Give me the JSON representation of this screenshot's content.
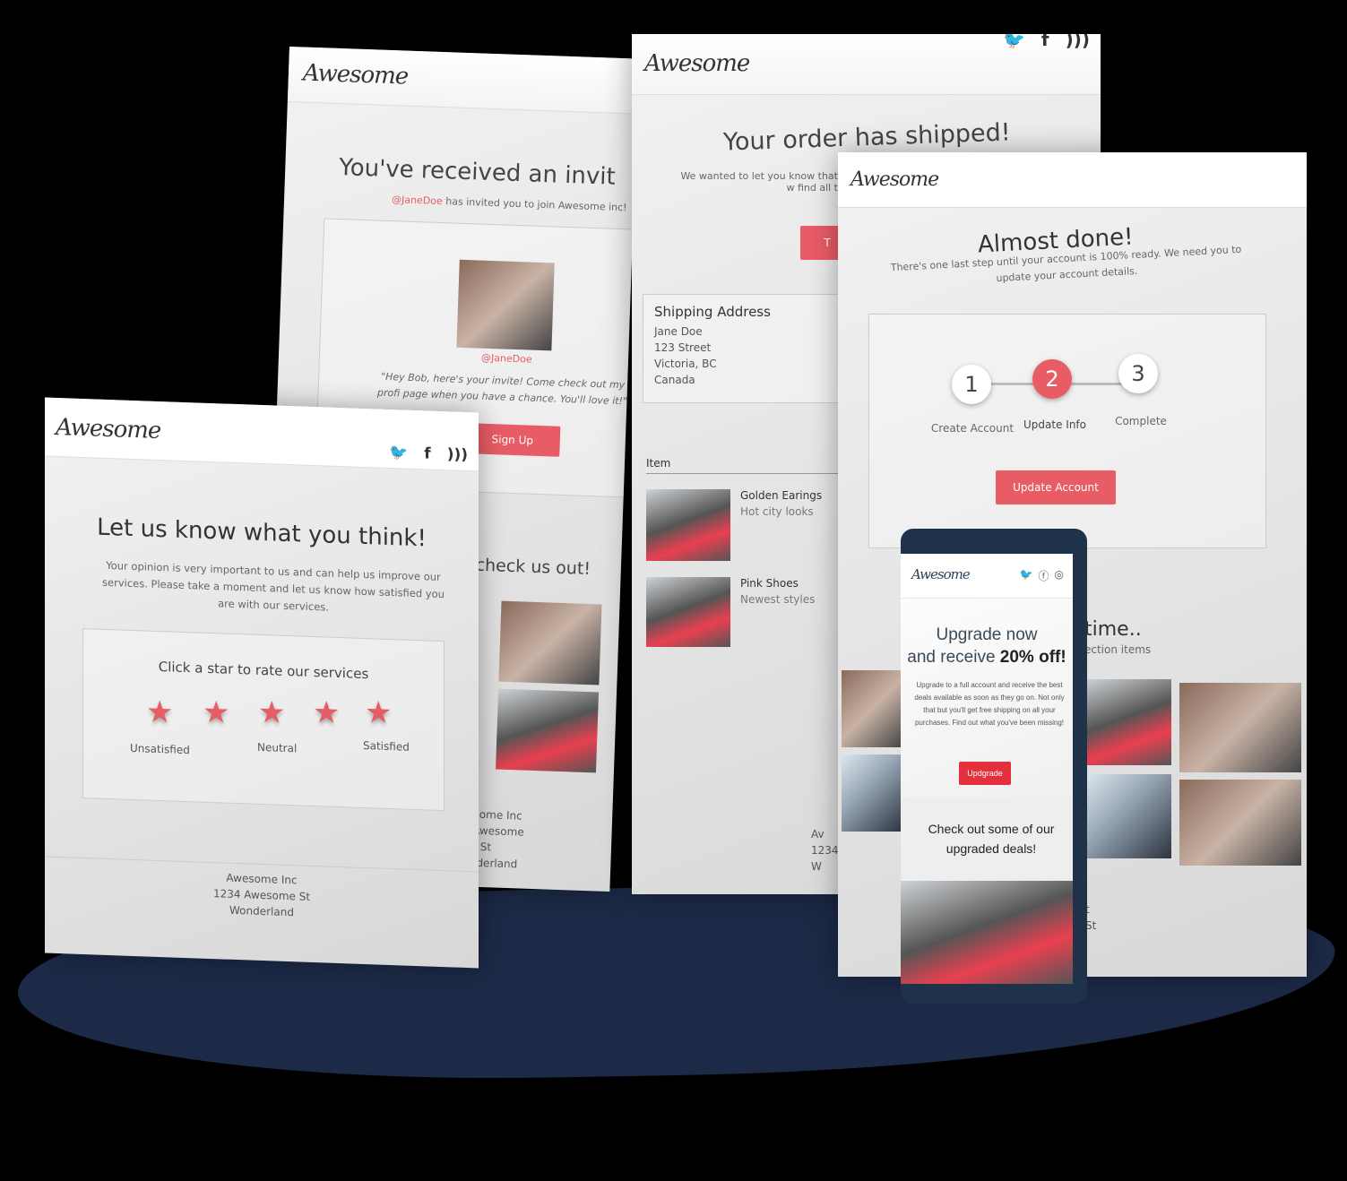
{
  "brand": "Awesome",
  "accent": "#e85c66",
  "invite": {
    "title": "You've received an invit",
    "handle": "@JaneDoe",
    "subtitle": " has invited you to join Awesome inc!",
    "avatar_handle": "@JaneDoe",
    "quote": "\"Hey Bob, here's your invite! Come check out my profi page when you have a chance. You'll love it!\"",
    "button": "Sign Up",
    "section": "e check us out!",
    "footer": [
      "Awesome Inc",
      "234 Awesome St",
      "Wonderland"
    ]
  },
  "shipped": {
    "social": [
      "twitter-icon",
      "facebook-icon",
      "rss-icon"
    ],
    "title": "Your order has shipped!",
    "body": "We wanted to let you know that w find all t",
    "button": "T",
    "address_title": "Shipping Address",
    "address": [
      "Jane Doe",
      "123 Street",
      "Victoria, BC",
      "Canada"
    ],
    "item_header": "Item",
    "items": [
      {
        "name": "Golden Earings",
        "desc": "Hot city looks"
      },
      {
        "name": "Pink Shoes",
        "desc": "Newest styles"
      }
    ],
    "footer": [
      "Av",
      "1234",
      "W"
    ]
  },
  "almost": {
    "title": "Almost done!",
    "body": "There's one last step until your account is 100% ready. We need you to update your account details.",
    "steps": [
      {
        "num": "1",
        "label": "Create Account"
      },
      {
        "num": "2",
        "label": "Update Info"
      },
      {
        "num": "3",
        "label": "Complete"
      }
    ],
    "active_step": 2,
    "button": "Update Account",
    "section_title": "time..",
    "section_sub": "ection items",
    "footer": [
      "t",
      "St"
    ]
  },
  "feedback": {
    "title": "Let us know what you think!",
    "body": "Your opinion is very important to us and can help us improve our services. Please take a moment and let us know how satisfied you are with our services.",
    "prompt": "Click a star to rate our services",
    "labels": [
      "Unsatisfied",
      "Neutral",
      "Satisfied"
    ],
    "stars": 5,
    "footer": [
      "Awesome Inc",
      "1234 Awesome St",
      "Wonderland"
    ]
  },
  "mobile": {
    "social": [
      "twitter-icon",
      "facebook-icon",
      "instagram-icon"
    ],
    "title1": "Upgrade now",
    "title2a": "and receive ",
    "title2b": "20% off!",
    "body": "Upgrade to a full account and receive the best deals available as soon as they go on. Not only that but you'll get free shipping on all your purchases. Find out what you've been missing!",
    "button": "Updgrade",
    "section": "Check out some of our upgraded deals!"
  }
}
